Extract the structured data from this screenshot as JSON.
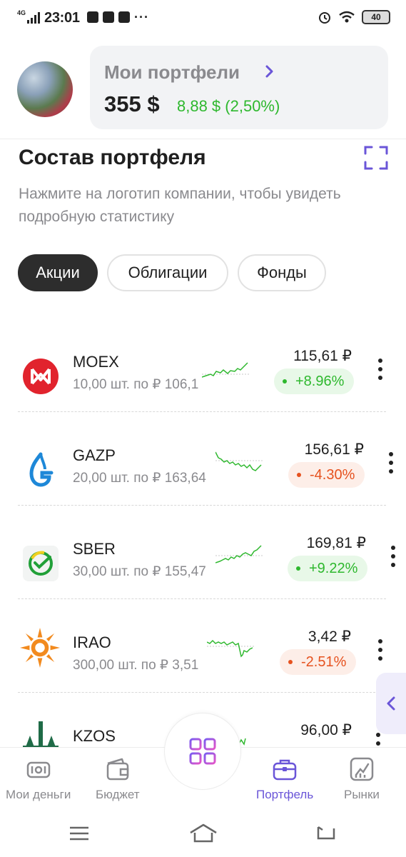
{
  "status_bar": {
    "network": "4G",
    "time": "23:01",
    "battery": "40"
  },
  "header": {
    "portfolio_title": "Мои портфели",
    "total": "355 $",
    "change": "8,88 $ (2,50%)"
  },
  "section": {
    "title": "Состав портфеля",
    "subtitle": "Нажмите на логотип компании, чтобы увидеть подробную статистику"
  },
  "tabs": [
    {
      "label": "Акции",
      "active": true
    },
    {
      "label": "Облигации",
      "active": false
    },
    {
      "label": "Фонды",
      "active": false
    }
  ],
  "holdings": [
    {
      "ticker": "MOEX",
      "qty": "10,00 шт. по ₽ 106,1",
      "price": "115,61 ₽",
      "change": "+8.96%",
      "direction": "up",
      "logo": "moex-logo"
    },
    {
      "ticker": "GAZP",
      "qty": "20,00 шт. по ₽ 163,64",
      "price": "156,61 ₽",
      "change": "-4.30%",
      "direction": "down",
      "logo": "gazprom-logo"
    },
    {
      "ticker": "SBER",
      "qty": "30,00 шт. по ₽ 155,47",
      "price": "169,81 ₽",
      "change": "+9.22%",
      "direction": "up",
      "logo": "sber-logo"
    },
    {
      "ticker": "IRAO",
      "qty": "300,00 шт. по ₽ 3,51",
      "price": "3,42 ₽",
      "change": "-2.51%",
      "direction": "down",
      "logo": "interrao-logo"
    },
    {
      "ticker": "KZOS",
      "qty": "",
      "price": "96,00 ₽",
      "change": "",
      "direction": "up",
      "logo": "kazanorgsintez-logo"
    }
  ],
  "bottom_nav": [
    {
      "label": "Мои деньги",
      "icon": "money-icon",
      "active": false
    },
    {
      "label": "Бюджет",
      "icon": "wallet-icon",
      "active": false
    },
    {
      "label": "Портфель",
      "icon": "briefcase-icon",
      "active": true
    },
    {
      "label": "Рынки",
      "icon": "market-chart-icon",
      "active": false
    }
  ],
  "colors": {
    "accent": "#6a55d8",
    "positive": "#2eb82e",
    "negative": "#e6521f"
  }
}
